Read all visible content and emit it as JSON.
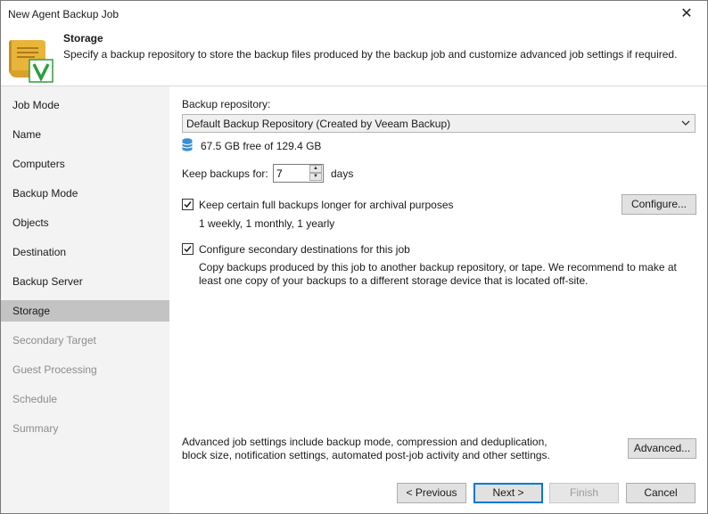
{
  "window": {
    "title": "New Agent Backup Job",
    "close_glyph": "✕"
  },
  "header": {
    "title": "Storage",
    "description": "Specify a backup repository to store the backup files produced by the backup job and customize advanced job settings if required.",
    "icon": "scroll-checkmark-icon"
  },
  "sidebar": {
    "items": [
      {
        "label": "Job Mode",
        "state": "normal"
      },
      {
        "label": "Name",
        "state": "normal"
      },
      {
        "label": "Computers",
        "state": "normal"
      },
      {
        "label": "Backup Mode",
        "state": "normal"
      },
      {
        "label": "Objects",
        "state": "normal"
      },
      {
        "label": "Destination",
        "state": "normal"
      },
      {
        "label": "Backup Server",
        "state": "normal"
      },
      {
        "label": "Storage",
        "state": "active"
      },
      {
        "label": "Secondary Target",
        "state": "disabled"
      },
      {
        "label": "Guest Processing",
        "state": "disabled"
      },
      {
        "label": "Schedule",
        "state": "disabled"
      },
      {
        "label": "Summary",
        "state": "disabled"
      }
    ]
  },
  "storage": {
    "repository_label": "Backup repository:",
    "repository_value": "Default Backup Repository (Created by Veeam Backup)",
    "free_space": "67.5 GB free of 129.4 GB",
    "keep_label": "Keep backups for:",
    "keep_value": "7",
    "keep_unit": "days",
    "archival": {
      "checked": true,
      "label": "Keep certain full backups longer for archival purposes",
      "detail": "1 weekly, 1 monthly, 1 yearly",
      "button": "Configure..."
    },
    "secondary": {
      "checked": true,
      "label": "Configure secondary destinations for this job",
      "description_line1": "Copy backups produced by this job to another backup repository, or tape. We recommend to make at",
      "description_line2": "least one copy of your backups to a different storage device that is located off-site."
    },
    "advanced": {
      "text_line1": "Advanced job settings include backup mode, compression and deduplication,",
      "text_line2": "block size, notification settings, automated post-job activity and other settings.",
      "button": "Advanced..."
    }
  },
  "footer": {
    "previous": "< Previous",
    "next": "Next >",
    "finish": "Finish",
    "cancel": "Cancel"
  },
  "colors": {
    "accent": "#0078d7",
    "sidebar_bg": "#f3f3f3",
    "sidebar_active": "#c3c3c3",
    "icon_green": "#2e9e3e",
    "icon_scroll": "#e8b53a",
    "db_icon": "#3a8fd6"
  }
}
